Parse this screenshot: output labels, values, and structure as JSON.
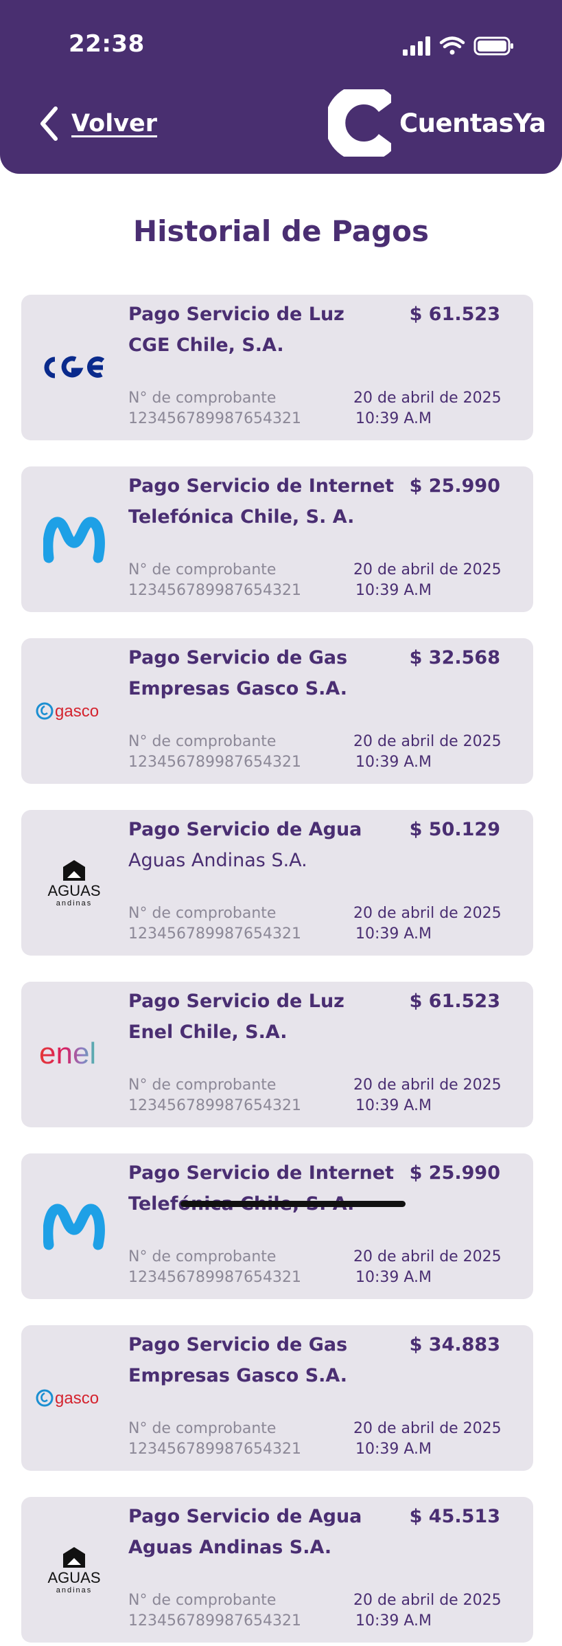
{
  "status_bar": {
    "time": "22:38"
  },
  "header": {
    "back_label": "Volver",
    "brand_name": "CuentasYa"
  },
  "page_title": "Historial de Pagos",
  "colors": {
    "header_bg": "#492f70",
    "card_bg": "#e7e4eb",
    "primary_text": "#4a2e72",
    "muted_text": "#8c8897"
  },
  "payments": [
    {
      "service": "Pago Servicio de Luz",
      "provider": "CGE Chile, S.A.",
      "amount": "$ 61.523",
      "receipt_label": "N° de comprobante",
      "receipt_number": "123456789987654321",
      "date": "20 de abril de 2025",
      "time": "10:39 A.M",
      "logo": "cge-logo"
    },
    {
      "service": "Pago Servicio de Internet",
      "provider": "Telefónica Chile, S. A.",
      "amount": "$ 25.990",
      "receipt_label": "N° de comprobante",
      "receipt_number": "123456789987654321",
      "date": "20 de abril de 2025",
      "time": "10:39 A.M",
      "logo": "movistar-logo"
    },
    {
      "service": "Pago Servicio de Gas",
      "provider": "Empresas Gasco S.A.",
      "amount": "$ 32.568",
      "receipt_label": "N° de comprobante",
      "receipt_number": "123456789987654321",
      "date": "20 de abril de 2025",
      "time": "10:39 A.M",
      "logo": "gasco-logo",
      "logo_text": "gasco"
    },
    {
      "service": "Pago Servicio de Agua",
      "provider": "Aguas Andinas S.A.",
      "amount": "$ 50.129",
      "receipt_label": "N° de comprobante",
      "receipt_number": "123456789987654321",
      "date": "20 de abril de 2025",
      "time": "10:39 A.M",
      "logo": "aguas-andinas-logo",
      "logo_text": "AGUAS",
      "logo_subtext": "andinas"
    },
    {
      "service": "Pago Servicio de Luz",
      "provider": "Enel Chile, S.A.",
      "amount": "$ 61.523",
      "receipt_label": "N° de comprobante",
      "receipt_number": "123456789987654321",
      "date": "20 de abril de 2025",
      "time": "10:39 A.M",
      "logo": "enel-logo",
      "logo_text": "enel"
    },
    {
      "service": "Pago Servicio de Internet",
      "provider": "Telefónica Chile, S. A.",
      "amount": "$ 25.990",
      "receipt_label": "N° de comprobante",
      "receipt_number": "123456789987654321",
      "date": "20 de abril de 2025",
      "time": "10:39 A.M",
      "logo": "movistar-logo"
    },
    {
      "service": "Pago Servicio de Gas",
      "provider": "Empresas Gasco S.A.",
      "amount": "$ 34.883",
      "receipt_label": "N° de comprobante",
      "receipt_number": "123456789987654321",
      "date": "20 de abril de 2025",
      "time": "10:39 A.M",
      "logo": "gasco-logo",
      "logo_text": "gasco"
    },
    {
      "service": "Pago Servicio de Agua",
      "provider": "Aguas Andinas S.A.",
      "amount": "$ 45.513",
      "receipt_label": "N° de comprobante",
      "receipt_number": "123456789987654321",
      "date": "20 de abril de 2025",
      "time": "10:39 A.M",
      "logo": "aguas-andinas-logo",
      "logo_text": "AGUAS",
      "logo_subtext": "andinas"
    }
  ]
}
